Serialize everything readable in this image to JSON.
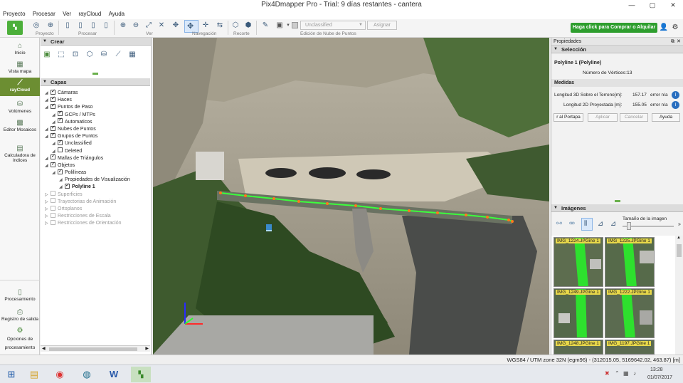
{
  "window": {
    "title": "Pix4Dmapper Pro - Trial: 9 días restantes - cantera"
  },
  "menu": [
    "Proyecto",
    "Procesar",
    "Ver",
    "rayCloud",
    "Ayuda"
  ],
  "toolbar": {
    "groups": [
      "Proyecto",
      "Procesar",
      "Ver",
      "Navegación",
      "Recorte",
      "Edición de Nube de Puntos"
    ],
    "class_select": "Unclassified",
    "assign_button": "Asignar",
    "buy_button": "Haga click para Comprar o Alquilar",
    "colors": {
      "buy_bg": "#2e9e2e"
    }
  },
  "leftnav": {
    "items": [
      {
        "label": "Inicio",
        "icon": "home-icon"
      },
      {
        "label": "Vista mapa",
        "icon": "map-icon"
      },
      {
        "label": "rayCloud",
        "icon": "raycloud-icon"
      },
      {
        "label": "Volúmenes",
        "icon": "volume-icon"
      },
      {
        "label": "Editor Mosaicos",
        "icon": "mosaic-icon"
      },
      {
        "label": "Calculadora de índices",
        "icon": "calculator-icon"
      }
    ],
    "bottom": [
      {
        "label": "Procesamiento",
        "icon": "processing-icon"
      },
      {
        "label": "Registro de salida",
        "icon": "log-icon"
      },
      {
        "label": "Opciones de procesamiento",
        "icon": "gear-icon"
      }
    ]
  },
  "create_panel": {
    "title": "Crear"
  },
  "layers_panel": {
    "title": "Capas",
    "rows": [
      {
        "label": "Cámaras",
        "level": 0,
        "check": true,
        "disabled": false
      },
      {
        "label": "Haces",
        "level": 0,
        "check": true,
        "disabled": false
      },
      {
        "label": "Puntos de Paso",
        "level": 0,
        "check": true,
        "disabled": false
      },
      {
        "label": "GCPs / MTPs",
        "level": 1,
        "check": true,
        "disabled": false
      },
      {
        "label": "Automaticos",
        "level": 1,
        "check": true,
        "disabled": false
      },
      {
        "label": "Nubes de Puntos",
        "level": 0,
        "check": true,
        "disabled": false
      },
      {
        "label": "Grupos de Puntos",
        "level": 0,
        "check": true,
        "disabled": false
      },
      {
        "label": "Unclassified",
        "level": 1,
        "check": true,
        "disabled": false
      },
      {
        "label": "Deleted",
        "level": 1,
        "check": false,
        "disabled": false
      },
      {
        "label": "Mallas de Triángulos",
        "level": 0,
        "check": true,
        "disabled": false
      },
      {
        "label": "Objetos",
        "level": 0,
        "check": true,
        "disabled": false
      },
      {
        "label": "Polilíneas",
        "level": 1,
        "check": true,
        "disabled": false
      },
      {
        "label": "Propiedades de Visualización",
        "level": 2,
        "check": null,
        "disabled": false
      },
      {
        "label": "Polyline 1",
        "level": 2,
        "check": true,
        "disabled": false
      },
      {
        "label": "Superficies",
        "level": 0,
        "check": false,
        "disabled": true
      },
      {
        "label": "Trayectorias de Animación",
        "level": 0,
        "check": false,
        "disabled": true
      },
      {
        "label": "Ortoplanos",
        "level": 0,
        "check": false,
        "disabled": true
      },
      {
        "label": "Restricciones de Escala",
        "level": 0,
        "check": false,
        "disabled": true
      },
      {
        "label": "Restricciones de Orientación",
        "level": 0,
        "check": false,
        "disabled": true
      }
    ]
  },
  "properties": {
    "title": "Propiedades",
    "selection_header": "Selección",
    "object_name": "Polyline 1 (Polyline)",
    "vertices_label": "Número de Vértices:",
    "vertices_value": "13",
    "measures_header": "Medidas",
    "length3d_label": "Longitud 3D Sobre el Terreno[m]:",
    "length3d_value": "157.17",
    "length3d_error": "error n/a",
    "length2d_label": "Longitud 2D Proyectada [m]:",
    "length2d_value": "155.05",
    "length2d_error": "error n/a",
    "buttons": [
      "r al Portapa",
      "Aplicar",
      "Cancelar",
      "Ayuda"
    ]
  },
  "images": {
    "header": "Imágenes",
    "size_label": "Tamaño de la imagen",
    "thumbs": [
      "IMG_1224.JPGine 1",
      "IMG_1225.JPGine 1",
      "IMG_1249.JPGine 1",
      "IMG_1222.JPGine 1",
      "IMG_1248.JPGine 1",
      "IMG_1197.JPGine 1"
    ]
  },
  "status": {
    "coords": "WGS84 / UTM zone 32N (egm96) - (312015.05, 5169642.02, 463.87) [m]"
  },
  "taskbar": {
    "time": "13:28",
    "date": "01/07/2017"
  }
}
